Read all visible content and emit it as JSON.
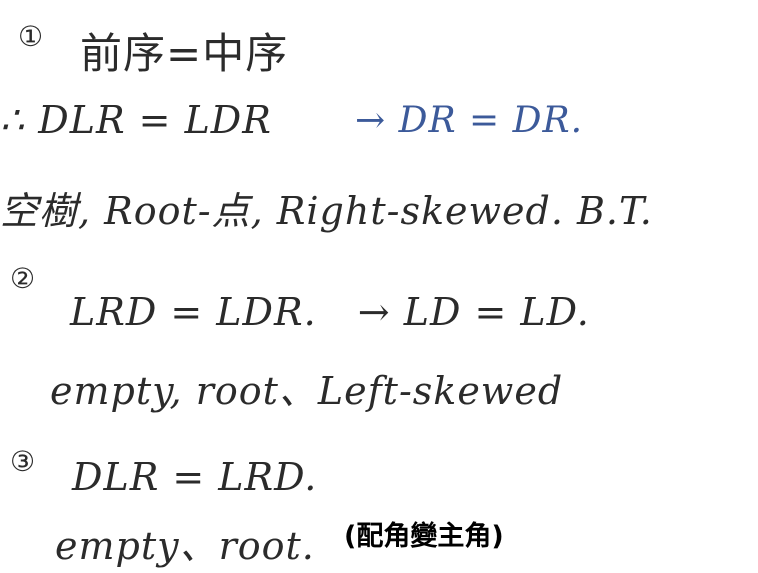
{
  "notes": {
    "item1": {
      "number": "①",
      "heading": "前序=中序",
      "formula": "∴ DLR = LDR",
      "result": "→ DR = DR.",
      "cases": "空樹, Root-点, Right-skewed. B.T."
    },
    "item2": {
      "number": "②",
      "formula": "LRD = LDR.",
      "result": "→ LD = LD.",
      "cases": "empty, root、Left-skewed"
    },
    "item3": {
      "number": "③",
      "formula": "DLR = LRD.",
      "cases": "empty、root.",
      "annotation": "(配角變主角)"
    }
  },
  "colors": {
    "ink": "#2b2b2b",
    "blue_ink": "#3c5a9a",
    "annotation": "#000000"
  }
}
